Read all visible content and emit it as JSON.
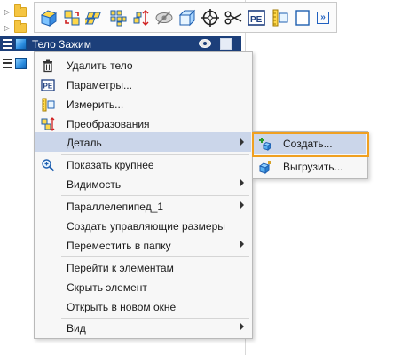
{
  "tree": {
    "selected_item": {
      "label": "Тело Зажим"
    }
  },
  "toolbar": {
    "buttons": [
      {
        "icon": "solid-cube-icon"
      },
      {
        "icon": "transform-shape-icon"
      },
      {
        "icon": "point-array-icon"
      },
      {
        "icon": "point-grid-icon"
      },
      {
        "icon": "measure-arrows-icon"
      },
      {
        "icon": "hide-eye-icon"
      },
      {
        "icon": "wireframe-cube-icon"
      },
      {
        "icon": "crosshair-icon"
      },
      {
        "icon": "scissors-icon"
      },
      {
        "icon": "parameters-icon"
      },
      {
        "icon": "measure-ruler-icon"
      },
      {
        "icon": "frame-icon"
      }
    ],
    "overflow_label": "»"
  },
  "context_menu": {
    "items": [
      {
        "label": "Удалить тело",
        "icon": "trash-icon",
        "submenu": false
      },
      {
        "label": "Параметры...",
        "icon": "parameters-icon",
        "submenu": false
      },
      {
        "label": "Измерить...",
        "icon": "measure-icon",
        "submenu": false
      },
      {
        "label": "Преобразования",
        "icon": "transform-icon",
        "submenu": false
      },
      {
        "label": "Деталь",
        "icon": "",
        "submenu": true,
        "highlighted": true
      },
      {
        "label": "Показать крупнее",
        "icon": "zoom-icon",
        "submenu": false
      },
      {
        "label": "Видимость",
        "icon": "",
        "submenu": true
      },
      {
        "label": "Параллелепипед_1",
        "icon": "",
        "submenu": true
      },
      {
        "label": "Создать управляющие размеры",
        "icon": "",
        "submenu": false
      },
      {
        "label": "Переместить в папку",
        "icon": "",
        "submenu": true
      },
      {
        "label": "Перейти к элементам",
        "icon": "",
        "submenu": false
      },
      {
        "label": "Скрыть элемент",
        "icon": "",
        "submenu": false
      },
      {
        "label": "Открыть в новом окне",
        "icon": "",
        "submenu": false
      },
      {
        "label": "Вид",
        "icon": "",
        "submenu": true
      }
    ]
  },
  "submenu": {
    "items": [
      {
        "label": "Создать...",
        "icon": "create-part-icon",
        "highlighted": true
      },
      {
        "label": "Выгрузить...",
        "icon": "export-part-icon"
      }
    ]
  },
  "colors": {
    "selection": "#1c3f7a",
    "menu_highlight": "#cbd6ea",
    "focus_ring": "#f0a020",
    "accent_blue": "#2b8de0"
  }
}
